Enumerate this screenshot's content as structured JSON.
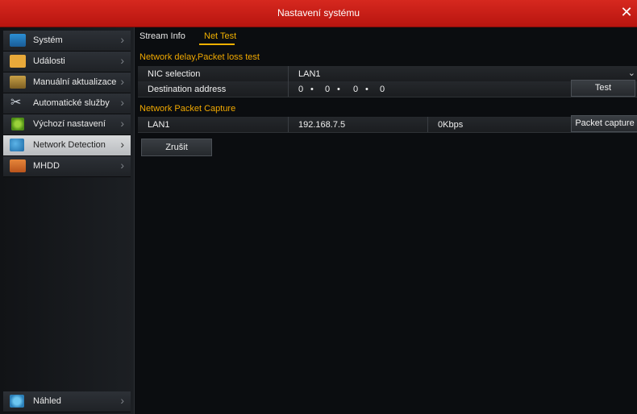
{
  "titlebar": {
    "title": "Nastavení systému",
    "close_label": "✕"
  },
  "sidebar": {
    "items": [
      {
        "label": "Systém",
        "icon": "monitor-icon"
      },
      {
        "label": "Události",
        "icon": "events-icon"
      },
      {
        "label": "Manuální aktualizace",
        "icon": "update-icon"
      },
      {
        "label": "Automatické služby",
        "icon": "tools-icon"
      },
      {
        "label": "Výchozí nastavení",
        "icon": "default-icon"
      },
      {
        "label": "Network Detection",
        "icon": "network-icon"
      },
      {
        "label": "MHDD",
        "icon": "disk-icon"
      }
    ],
    "bottom_item": {
      "label": "Náhled",
      "icon": "preview-icon"
    },
    "chevron": "›"
  },
  "tabs": [
    {
      "label": "Stream Info"
    },
    {
      "label": "Net Test"
    }
  ],
  "net_test": {
    "section_title": "Network delay,Packet loss test",
    "nic_label": "NIC selection",
    "nic_value": "LAN1",
    "dest_label": "Destination address",
    "ip_parts": [
      "0",
      "0",
      "0",
      "0"
    ],
    "ip_sep": "•",
    "test_button": "Test"
  },
  "capture": {
    "section_title": "Network Packet Capture",
    "nic": "LAN1",
    "ip": "192.168.7.5",
    "rate": "0Kbps",
    "button": "Packet capture"
  },
  "cancel_button": "Zrušit",
  "colors": {
    "accent": "#f0b000",
    "titlebar": "#c81d15"
  }
}
